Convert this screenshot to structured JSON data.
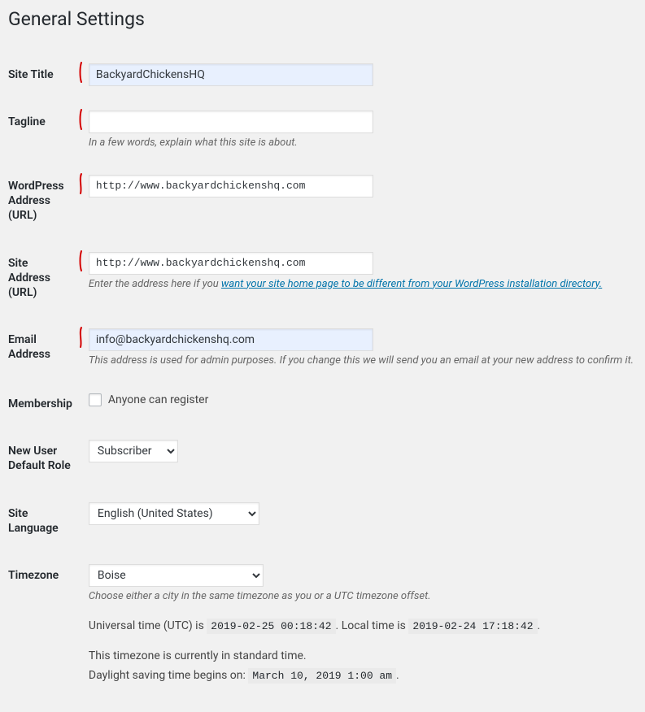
{
  "page_title": "General Settings",
  "fields": {
    "site_title": {
      "label": "Site Title",
      "value": "BackyardChickensHQ"
    },
    "tagline": {
      "label": "Tagline",
      "value": "",
      "desc": "In a few words, explain what this site is about."
    },
    "wp_address": {
      "label": "WordPress Address (URL)",
      "value": "http://www.backyardchickenshq.com"
    },
    "site_address": {
      "label": "Site Address (URL)",
      "value": "http://www.backyardchickenshq.com",
      "desc_pre": "Enter the address here if you ",
      "desc_link": "want your site home page to be different from your WordPress installation directory."
    },
    "email": {
      "label": "Email Address",
      "value": "info@backyardchickenshq.com",
      "desc": "This address is used for admin purposes. If you change this we will send you an email at your new address to confirm it."
    },
    "membership": {
      "label": "Membership",
      "checkbox_label": "Anyone can register"
    },
    "default_role": {
      "label": "New User Default Role",
      "value": "Subscriber"
    },
    "site_lang": {
      "label": "Site Language",
      "value": "English (United States)"
    },
    "timezone": {
      "label": "Timezone",
      "value": "Boise",
      "desc": "Choose either a city in the same timezone as you or a UTC timezone offset.",
      "utc_label": "Universal time (UTC) is ",
      "utc_value": "2019-02-25 00:18:42",
      "local_label": ". Local time is ",
      "local_value": "2019-02-24 17:18:42",
      "period": ".",
      "std_note": "This timezone is currently in standard time.",
      "dst_label": "Daylight saving time begins on: ",
      "dst_value": "March 10, 2019 1:00 am"
    }
  }
}
